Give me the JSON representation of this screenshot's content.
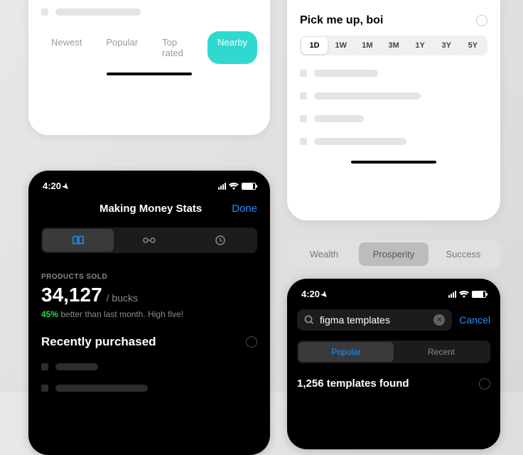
{
  "cardA": {
    "filters": [
      "Newest",
      "Popular",
      "Top rated",
      "Nearby"
    ],
    "active_filter": "Nearby"
  },
  "cardB": {
    "title": "Pick me up, boi",
    "ranges": [
      "1D",
      "1W",
      "1M",
      "3M",
      "1Y",
      "3Y",
      "5Y"
    ],
    "active_range": "1D"
  },
  "cardC": {
    "status_time": "4:20",
    "title": "Making Money Stats",
    "done": "Done",
    "stats_label": "PRODUCTS SOLD",
    "stats_value": "34,127",
    "stats_unit": "/ bucks",
    "delta_pct": "45%",
    "delta_text": " better than last month. High five!",
    "recent_title": "Recently purchased"
  },
  "standalone_seg": {
    "items": [
      "Wealth",
      "Prosperity",
      "Success"
    ],
    "active": "Prosperity"
  },
  "cardD": {
    "status_time": "4:20",
    "search_value": "figma templates",
    "cancel": "Cancel",
    "tabs": [
      "Popular",
      "Recent"
    ],
    "active_tab": "Popular",
    "results": "1,256 templates found"
  }
}
